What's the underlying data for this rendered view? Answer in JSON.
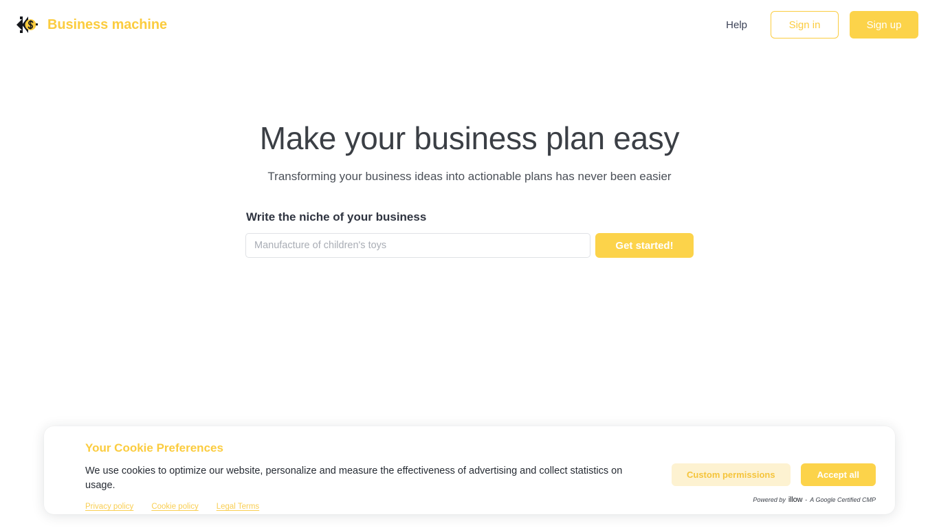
{
  "header": {
    "brand": {
      "name": "Business machine",
      "logo_icon": "business-machine-logo-icon",
      "color": "#FBCC3F"
    },
    "help_label": "Help",
    "sign_in_label": "Sign in",
    "sign_up_label": "Sign up"
  },
  "hero": {
    "title": "Make your business plan easy",
    "subtitle": "Transforming your business ideas into actionable plans has never been easier",
    "form": {
      "label": "Write the niche of your business",
      "input_value": "",
      "input_placeholder": "Manufacture of children's toys",
      "submit_label": "Get started!"
    }
  },
  "cookie_banner": {
    "title": "Your Cookie Preferences",
    "body": "We use cookies to optimize our website, personalize and measure the effectiveness of advertising and collect statistics on usage.",
    "links": [
      {
        "label": "Privacy policy"
      },
      {
        "label": "Cookie policy"
      },
      {
        "label": "Legal Terms"
      }
    ],
    "custom_label": "Custom permissions",
    "accept_label": "Accept all",
    "powered_prefix": "Powered by",
    "powered_brand": "illow",
    "powered_separator": "-",
    "powered_suffix": "A Google Certified CMP"
  },
  "colors": {
    "accent": "#FCD34A",
    "accent_text": "#FBCC3F",
    "accent_soft": "#FDF2D1",
    "text_dark": "#3b3f45",
    "background": "#ffffff"
  }
}
